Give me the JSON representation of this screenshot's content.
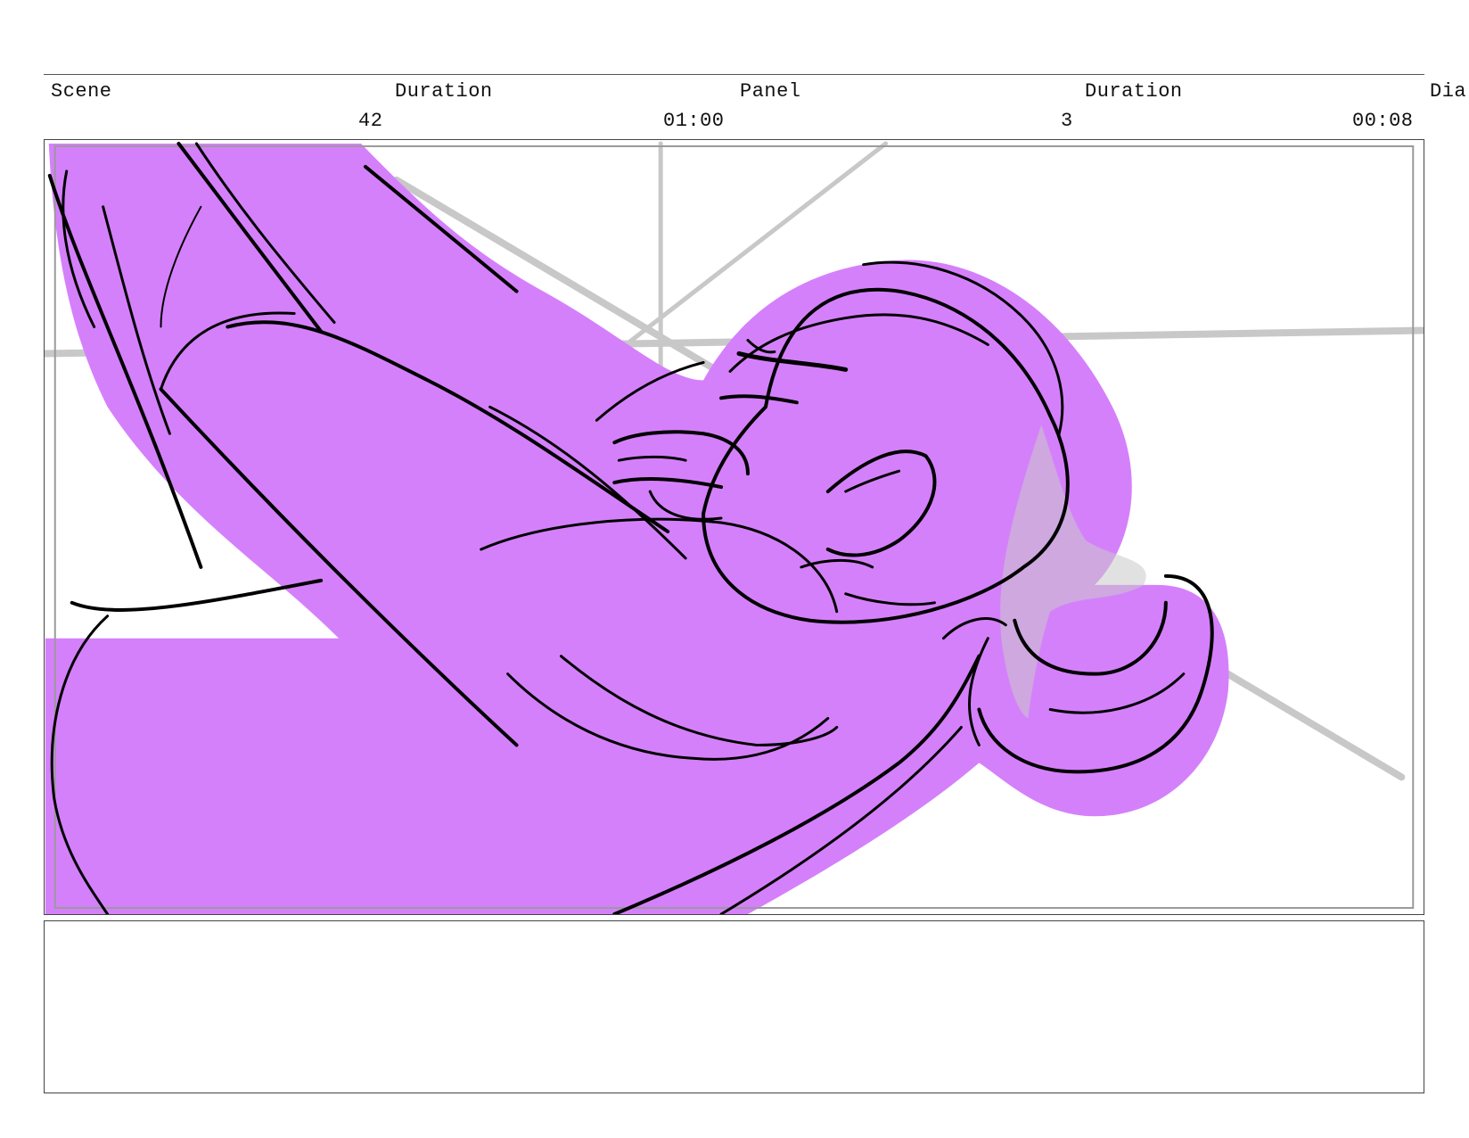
{
  "header": {
    "scene_label": "Scene",
    "scene_duration_label": "Duration",
    "panel_label": "Panel",
    "panel_duration_label": "Duration",
    "dialogue_label": "Dia",
    "scene_number": "42",
    "scene_duration": "01:00",
    "panel_number": "3",
    "panel_duration": "00:08"
  },
  "artwork": {
    "fill_color": "#d580fb",
    "line_color": "#000000",
    "guide_color": "#c8c8c8",
    "safe_area_color": "#9a9a9a"
  },
  "notes": {
    "text": ""
  }
}
